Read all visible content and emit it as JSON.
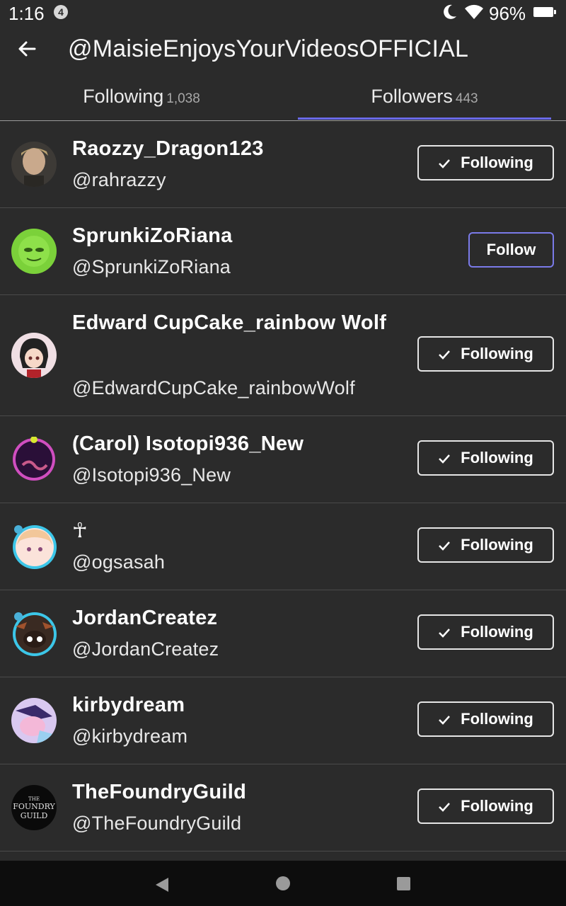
{
  "status_bar": {
    "time": "1:16",
    "notification_count": "4",
    "battery": "96%"
  },
  "header": {
    "title": "@MaisieEnjoysYourVideosOFFICIAL"
  },
  "tabs": [
    {
      "label": "Following",
      "count": "1,038"
    },
    {
      "label": "Followers",
      "count": "443"
    }
  ],
  "users": [
    {
      "name": "Raozzy_Dragon123",
      "handle": "@rahrazzy",
      "button": "Following"
    },
    {
      "name": "SprunkiZoRiana",
      "handle": "@SprunkiZoRiana",
      "button": "Follow"
    },
    {
      "name": "Edward CupCake_rainbow Wolf",
      "handle": "@EdwardCupCake_rainbowWolf",
      "button": "Following"
    },
    {
      "name": "(Carol) Isotopi936_New",
      "handle": "@Isotopi936_New",
      "button": "Following"
    },
    {
      "name": "☥",
      "handle": "@ogsasah",
      "button": "Following"
    },
    {
      "name": "JordanCreatez",
      "handle": "@JordanCreatez",
      "button": "Following"
    },
    {
      "name": "kirbydream",
      "handle": "@kirbydream",
      "button": "Following"
    },
    {
      "name": "TheFoundryGuild",
      "handle": "@TheFoundryGuild",
      "button": "Following"
    }
  ],
  "avatar_logo_text": "THE FOUNDRY GUILD",
  "colors": {
    "background": "#2b2b2b",
    "accent": "#6a6ae8",
    "navbar": "#0d0d0d"
  },
  "icons": [
    "back-arrow-icon",
    "moon-icon",
    "wifi-icon",
    "battery-icon",
    "checkmark-icon",
    "nav-back-icon",
    "nav-home-icon",
    "nav-recents-icon"
  ]
}
